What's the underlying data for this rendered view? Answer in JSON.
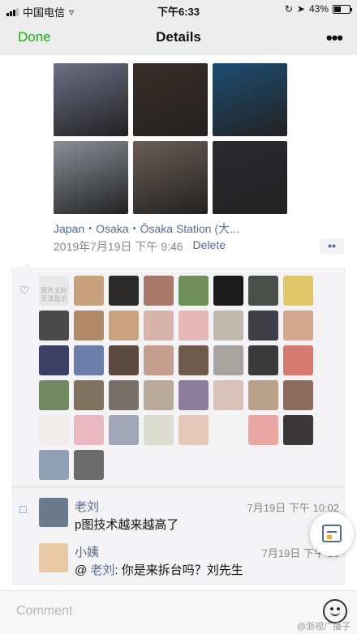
{
  "status_bar": {
    "carrier": "中国电信",
    "time": "下午6:33",
    "battery": "43%",
    "battery_level": 0.43,
    "icons": [
      "signal-icon",
      "wifi-icon",
      "orientation-lock-icon",
      "location-icon",
      "battery-icon"
    ]
  },
  "nav": {
    "done_label": "Done",
    "title": "Details",
    "more_icon": "more-icon"
  },
  "post": {
    "photos": [
      {
        "color": "#6d6f86"
      },
      {
        "color": "#3a2d27"
      },
      {
        "color": "#1d4d73"
      },
      {
        "color": "#8a8f96"
      },
      {
        "color": "#6b5e55"
      },
      {
        "color": "#2a2a30"
      }
    ],
    "location": "Japan・Osaka・Ōsaka Station (大...",
    "timestamp": "2019年7月19日 下午 9:46",
    "delete_label": "Delete"
  },
  "likes": {
    "placeholder_text": "照片太利 无法显示",
    "avatar_colors": [
      "#c8a27d",
      "#2d2a2a",
      "#a87868",
      "#6f8f5b",
      "#1b1b1b",
      "#4a4f49",
      "#e0c76a",
      "#4a4a4a",
      "#b08a66",
      "#c9a27f",
      "#d7b3a8",
      "#e3b8b6",
      "#c2b8ab",
      "#3e3e44",
      "#d3a78c",
      "#3b3f63",
      "#6a7fae",
      "#5a4a40",
      "#c59f8d",
      "#6f5a4c",
      "#a7a39e",
      "#3a3a3a",
      "#d67a72",
      "#6e8a5e",
      "#80705e",
      "#7a7068",
      "#b9a999",
      "#8c7c9e",
      "#d8c2b8",
      "#b8a089",
      "#8d6a5a",
      "#f0eeeb",
      "#e9b7c1",
      "#a0a6b5",
      "#dcdcd0",
      "#e3c9b6",
      "#f2f2f2",
      "#e8a7a0",
      "#3a3838",
      "#8da0b5",
      "#6b6b6b"
    ]
  },
  "comments": [
    {
      "avatar_color": "#6a7b8e",
      "name": "老刘",
      "time": "7月19日 下午 10:02",
      "text": "p图技术越来越高了"
    },
    {
      "avatar_color": "#e8c9a4",
      "name": "小姨",
      "time": "7月19日 下午 10",
      "prefix": "@ ",
      "mention": "老刘",
      "text": ": 你是来拆台吗？刘先生"
    }
  ],
  "composer": {
    "placeholder": "Comment"
  },
  "watermark": "@浙视广播子"
}
